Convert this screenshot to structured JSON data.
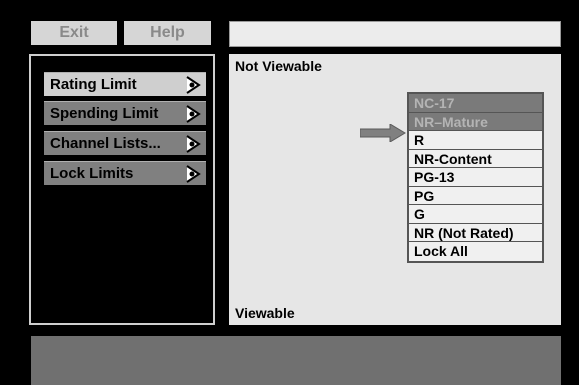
{
  "colors": {
    "background": "#000000",
    "button_bg": "#d6d6d6",
    "button_text": "#8a8a8a",
    "menu_selected": "#cfcfcf",
    "menu_unselected": "#808080",
    "locked_rating_bg": "#7a7a7a",
    "viewable_rating_bg": "#f0f0f0",
    "panel_bg": "#e6e6e6"
  },
  "toolbar": {
    "exit_label": "Exit",
    "help_label": "Help"
  },
  "title_bar": {
    "text": ""
  },
  "menu": {
    "items": [
      {
        "label": "Rating Limit",
        "icon": "arrow-right-icon",
        "selected": true
      },
      {
        "label": "Spending Limit",
        "icon": "arrow-right-icon",
        "selected": false
      },
      {
        "label": "Channel Lists...",
        "icon": "arrow-right-icon",
        "selected": false
      },
      {
        "label": "Lock Limits",
        "icon": "arrow-right-icon",
        "selected": false
      }
    ]
  },
  "rating_panel": {
    "top_label": "Not Viewable",
    "bottom_label": "Viewable",
    "pointer_icon": "pointer-arrow-icon",
    "ratings": [
      {
        "label": "NC-17",
        "state": "locked"
      },
      {
        "label": "NR–Mature",
        "state": "locked"
      },
      {
        "label": "R",
        "state": "viewable"
      },
      {
        "label": "NR-Content",
        "state": "viewable"
      },
      {
        "label": "PG-13",
        "state": "viewable"
      },
      {
        "label": "PG",
        "state": "viewable"
      },
      {
        "label": "G",
        "state": "viewable"
      },
      {
        "label": "NR (Not Rated)",
        "state": "viewable"
      },
      {
        "label": "Lock All",
        "state": "viewable"
      }
    ]
  },
  "status_bar": {
    "text": ""
  }
}
